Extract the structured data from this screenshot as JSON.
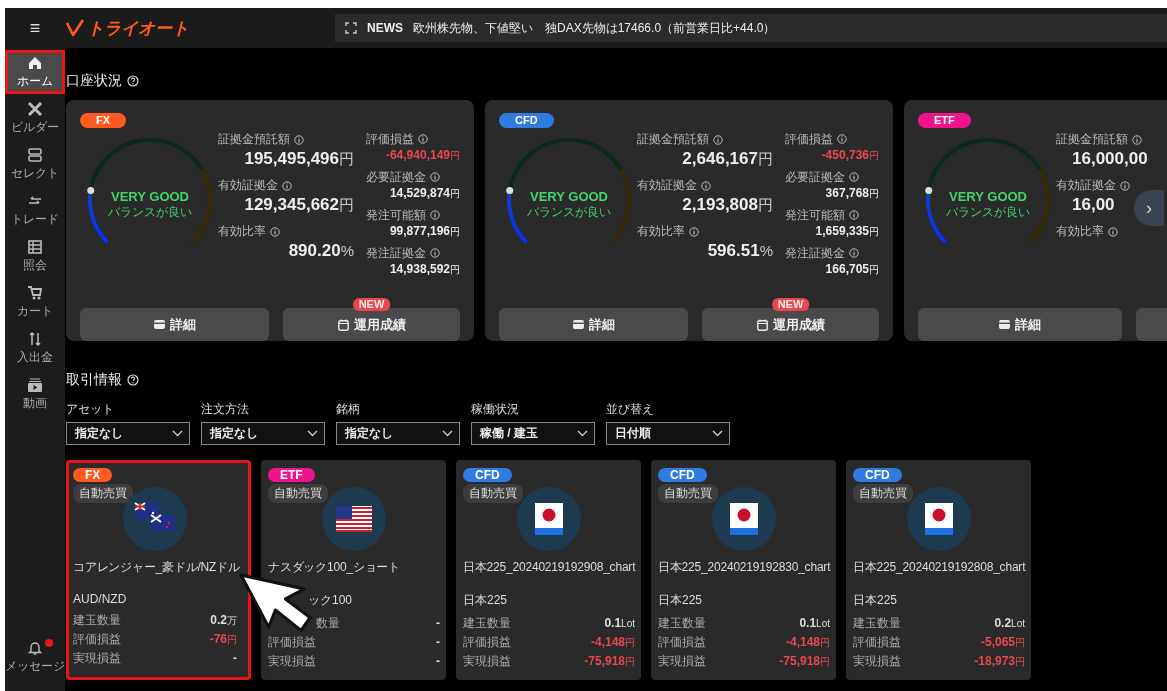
{
  "header": {
    "menu_icon": "≡",
    "logo": "トライオート",
    "news": {
      "tag": "NEWS",
      "text": "欧州株先物、下値堅い　独DAX先物は17466.0（前営業日比+44.0）"
    }
  },
  "sidebar": {
    "items": [
      {
        "label": "ホーム",
        "selected": true,
        "highlighted": true
      },
      {
        "label": "ビルダー",
        "selected": false,
        "highlighted": false
      },
      {
        "label": "セレクト",
        "selected": false,
        "highlighted": false
      },
      {
        "label": "トレード",
        "selected": false,
        "highlighted": false
      },
      {
        "label": "照会",
        "selected": false,
        "highlighted": false
      },
      {
        "label": "カート",
        "selected": false,
        "highlighted": false
      },
      {
        "label": "入出金",
        "selected": false,
        "highlighted": false
      },
      {
        "label": "動画",
        "selected": false,
        "highlighted": false
      }
    ],
    "message": {
      "label": "メッセージ",
      "unread": true
    }
  },
  "account": {
    "title": "口座状況",
    "cards": [
      {
        "badge": "FX",
        "color": "#ff5a1f",
        "gauge": {
          "level": 0.2,
          "status": "VERY GOOD",
          "note": "バランスが良い"
        },
        "main": [
          {
            "label": "証拠金預託額",
            "value": "195,495,496",
            "unit": "円"
          },
          {
            "label": "有効証拠金",
            "value": "129,345,662",
            "unit": "円"
          },
          {
            "label": "有効比率",
            "value": "890.20",
            "unit": "%"
          }
        ],
        "side": [
          {
            "label": "評価損益",
            "value": "-64,940,149",
            "unit": "円",
            "negative": true
          },
          {
            "label": "必要証拠金",
            "value": "14,529,874",
            "unit": "円",
            "negative": false
          },
          {
            "label": "発注可能額",
            "value": "99,877,196",
            "unit": "円",
            "negative": false
          },
          {
            "label": "発注証拠金",
            "value": "14,938,592",
            "unit": "円",
            "negative": false
          }
        ],
        "buttons": [
          {
            "kind": "detail",
            "label": "詳細"
          },
          {
            "kind": "report",
            "label": "運用成績",
            "badge": "NEW"
          }
        ]
      },
      {
        "badge": "CFD",
        "color": "#2f7be0",
        "gauge": {
          "level": 0.2,
          "status": "VERY GOOD",
          "note": "バランスが良い"
        },
        "main": [
          {
            "label": "証拠金預託額",
            "value": "2,646,167",
            "unit": "円"
          },
          {
            "label": "有効証拠金",
            "value": "2,193,808",
            "unit": "円"
          },
          {
            "label": "有効比率",
            "value": "596.51",
            "unit": "%"
          }
        ],
        "side": [
          {
            "label": "評価損益",
            "value": "-450,736",
            "unit": "円",
            "negative": true
          },
          {
            "label": "必要証拠金",
            "value": "367,768",
            "unit": "円",
            "negative": false
          },
          {
            "label": "発注可能額",
            "value": "1,659,335",
            "unit": "円",
            "negative": false
          },
          {
            "label": "発注証拠金",
            "value": "166,705",
            "unit": "円",
            "negative": false
          }
        ],
        "buttons": [
          {
            "kind": "detail",
            "label": "詳細"
          },
          {
            "kind": "report",
            "label": "運用成績",
            "badge": "NEW"
          }
        ]
      },
      {
        "badge": "ETF",
        "color": "#f0148c",
        "gauge": {
          "level": 0.2,
          "status": "VERY GOOD",
          "note": "バランスが良い"
        },
        "main": [
          {
            "label": "証拠金預託額",
            "value": "16,000,00"
          },
          {
            "label": "有効証拠金",
            "value": "16,00"
          },
          {
            "label": "有効比率"
          }
        ],
        "buttons": [
          {
            "kind": "detail",
            "label": "詳細"
          },
          {
            "kind": "blank"
          }
        ]
      }
    ],
    "next": "›"
  },
  "trading": {
    "title": "取引情報",
    "filters": [
      {
        "label": "アセット",
        "value": "指定なし"
      },
      {
        "label": "注文方法",
        "value": "指定なし"
      },
      {
        "label": "銘柄",
        "value": "指定なし"
      },
      {
        "label": "稼働状況",
        "value": "稼働 / 建玉"
      },
      {
        "label": "並び替え",
        "value": "日付順"
      }
    ],
    "cards": [
      {
        "badge": "FX",
        "color": "#ff5a1f",
        "tag": "自動売買",
        "kind": "aunz",
        "name": "コアレンジャー_豪ドル/NZドル",
        "asset": "AUD/NZD",
        "highlighted": true,
        "covered": false,
        "rows": [
          {
            "label": "建玉数量",
            "value": "0.2",
            "unit": "万",
            "negative": false
          },
          {
            "label": "評価損益",
            "value": "-76",
            "unit": "円",
            "negative": true
          },
          {
            "label": "実現損益",
            "value": "-",
            "negative": false
          }
        ]
      },
      {
        "badge": "ETF",
        "color": "#f0148c",
        "tag": "自動売買",
        "kind": "us",
        "name": "ナスダック100_ショート",
        "asset": "ック100",
        "highlighted": false,
        "covered": true,
        "rows": [
          {
            "label": "数量",
            "value": "-",
            "negative": false
          },
          {
            "label": "評価損益",
            "value": "-",
            "negative": false
          },
          {
            "label": "実現損益",
            "value": "-",
            "negative": false
          }
        ]
      },
      {
        "badge": "CFD",
        "color": "#2f7be0",
        "tag": "自動売買",
        "kind": "jp",
        "name": "日本225_20240219192908_chart",
        "asset": "日本225",
        "highlighted": false,
        "covered": false,
        "rows": [
          {
            "label": "建玉数量",
            "value": "0.1",
            "unit": "Lot",
            "negative": false
          },
          {
            "label": "評価損益",
            "value": "-4,148",
            "unit": "円",
            "negative": true
          },
          {
            "label": "実現損益",
            "value": "-75,918",
            "unit": "円",
            "negative": true
          }
        ]
      },
      {
        "badge": "CFD",
        "color": "#2f7be0",
        "tag": "自動売買",
        "kind": "jp",
        "name": "日本225_20240219192830_chart",
        "asset": "日本225",
        "highlighted": false,
        "covered": false,
        "rows": [
          {
            "label": "建玉数量",
            "value": "0.1",
            "unit": "Lot",
            "negative": false
          },
          {
            "label": "評価損益",
            "value": "-4,148",
            "unit": "円",
            "negative": true
          },
          {
            "label": "実現損益",
            "value": "-75,918",
            "unit": "円",
            "negative": true
          }
        ]
      },
      {
        "badge": "CFD",
        "color": "#2f7be0",
        "tag": "自動売買",
        "kind": "jp",
        "name": "日本225_20240219192808_chart",
        "asset": "日本225",
        "highlighted": false,
        "covered": false,
        "rows": [
          {
            "label": "建玉数量",
            "value": "0.2",
            "unit": "Lot",
            "negative": false
          },
          {
            "label": "評価損益",
            "value": "-5,065",
            "unit": "円",
            "negative": true
          },
          {
            "label": "実現損益",
            "value": "-18,973",
            "unit": "円",
            "negative": true
          }
        ]
      }
    ],
    "mouse_pointer": true
  }
}
